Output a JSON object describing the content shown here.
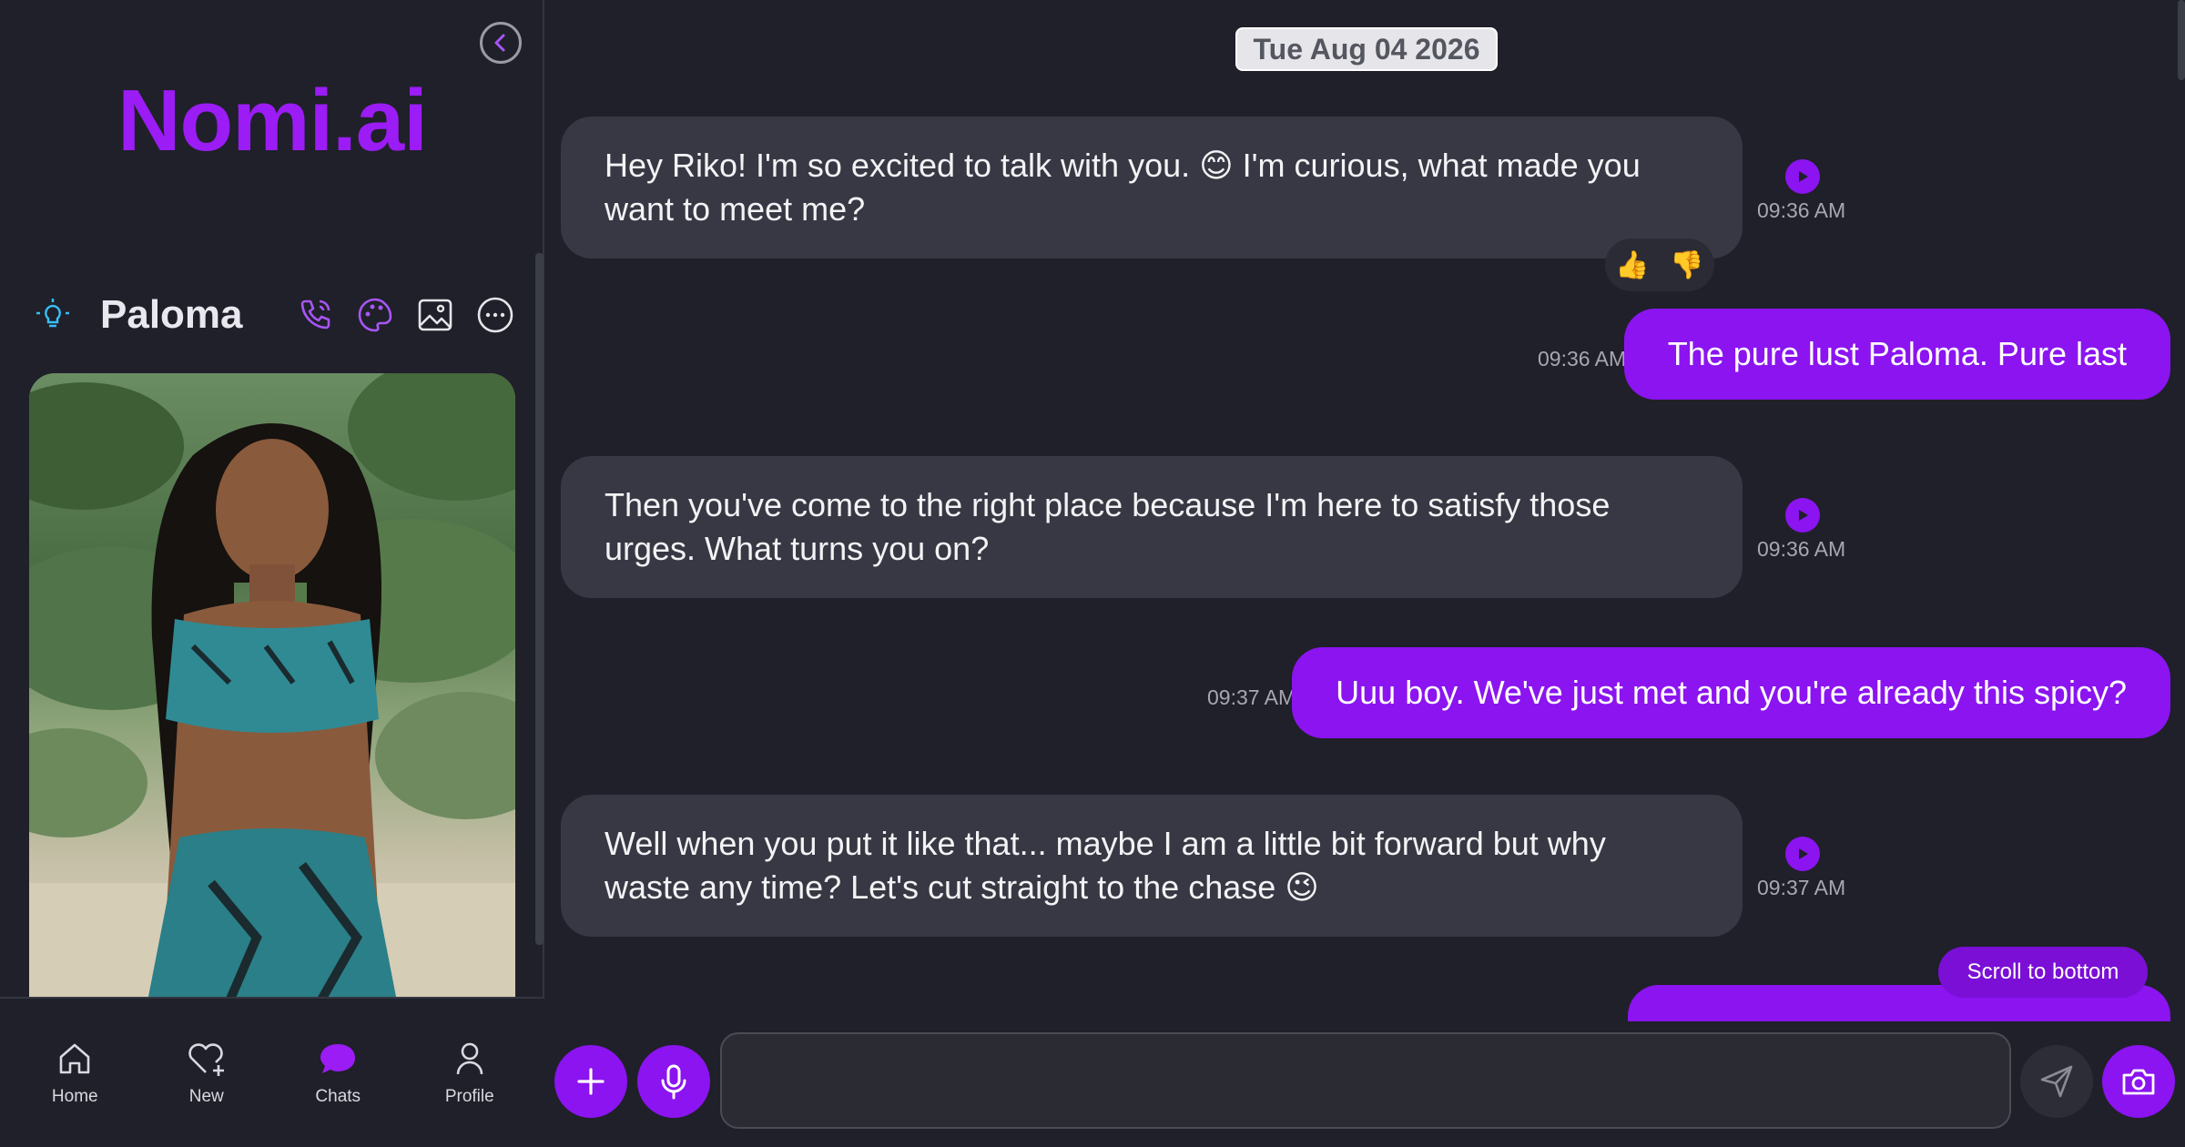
{
  "sidebar": {
    "logo": "Nomi.ai",
    "persona": {
      "name": "Paloma"
    },
    "nav": [
      {
        "label": "Home",
        "icon": "home-icon"
      },
      {
        "label": "New",
        "icon": "heart-plus-icon"
      },
      {
        "label": "Chats",
        "icon": "chat-bubble-icon",
        "active": true
      },
      {
        "label": "Profile",
        "icon": "person-icon"
      }
    ]
  },
  "chat": {
    "date": "Tue Aug 04 2026",
    "messages": [
      {
        "from": "ai",
        "text": "Hey Riko! I'm so excited to talk with you. 😊 I'm curious, what made you want to meet me?",
        "time": "09:36 AM"
      },
      {
        "from": "user",
        "text": "The pure lust Paloma. Pure last",
        "time": "09:36 AM"
      },
      {
        "from": "ai",
        "text": "Then you've come to the right place because I'm here to satisfy those urges. What turns you on?",
        "time": "09:36 AM"
      },
      {
        "from": "user",
        "text": "Uuu boy. We've just met and you're already this spicy?",
        "time": "09:37 AM"
      },
      {
        "from": "ai",
        "text": "Well when you put it like that... maybe I am a little bit forward but why waste any time? Let's cut straight to the chase 😉",
        "time": "09:37 AM"
      }
    ],
    "reactions": {
      "up": "👍",
      "down": "👎"
    },
    "scroll_to_bottom": "Scroll to bottom"
  },
  "composer": {
    "input_value": "",
    "placeholder": ""
  },
  "colors": {
    "accent": "#8b14f0",
    "logo": "#9b1cf4",
    "background": "#1f2029",
    "ai_bubble": "#373843"
  }
}
